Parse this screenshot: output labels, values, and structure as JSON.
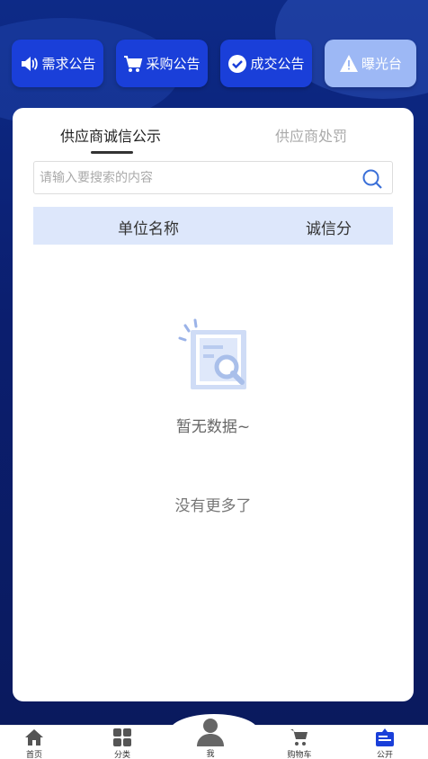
{
  "top_buttons": [
    {
      "label": "需求公告",
      "icon": "speaker-icon"
    },
    {
      "label": "采购公告",
      "icon": "cart-icon"
    },
    {
      "label": "成交公告",
      "icon": "check-circle-icon"
    },
    {
      "label": "曝光台",
      "icon": "warning-icon"
    }
  ],
  "tabs": [
    {
      "label": "供应商诚信公示",
      "active": true
    },
    {
      "label": "供应商处罚",
      "active": false
    }
  ],
  "search": {
    "placeholder": "请输入要搜索的内容",
    "value": ""
  },
  "table": {
    "columns": [
      "单位名称",
      "诚信分"
    ]
  },
  "empty": {
    "text": "暂无数据~",
    "footer": "没有更多了"
  },
  "bottom_nav": [
    {
      "label": "首页",
      "icon": "home-icon"
    },
    {
      "label": "分类",
      "icon": "grid-icon"
    },
    {
      "label": "我",
      "icon": "user-icon"
    },
    {
      "label": "购物车",
      "icon": "cart-icon"
    },
    {
      "label": "公开",
      "icon": "notice-board-icon"
    }
  ],
  "colors": {
    "primary": "#1a3fd9",
    "light_button": "#9db8f5",
    "table_head": "#dde7fb",
    "background": "#0d2a87"
  }
}
